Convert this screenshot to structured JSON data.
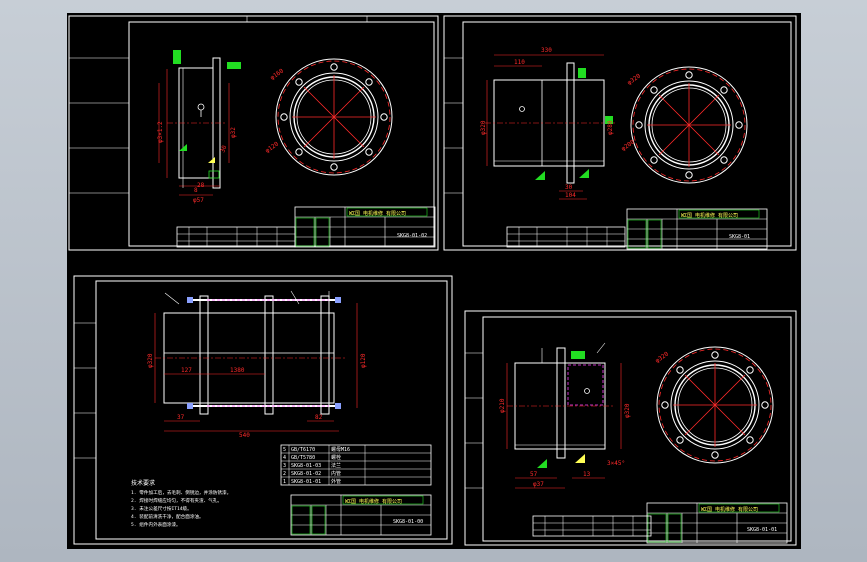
{
  "viewport": {
    "name": "model-space"
  },
  "sheets": [
    {
      "id": "top-left",
      "dims": {
        "d1": "φ57",
        "d2": "8",
        "d3": "30",
        "d4": "28",
        "d5": "φ3×1.2",
        "d6": "φ32"
      },
      "table_title": "WΣ国 电机维修 有限公司",
      "drawing_no": "SKG8-01-02"
    },
    {
      "id": "top-right",
      "dims": {
        "d1": "330",
        "d2": "110",
        "d3": "φ320",
        "d4": "30",
        "d5": "104",
        "d6": "φ280"
      },
      "table_title": "WΣ国 电机维修 有限公司",
      "drawing_no": "SKG8-01"
    },
    {
      "id": "bottom-left",
      "dims": {
        "d1": "127",
        "d2": "1380",
        "d3": "37",
        "d4": "82",
        "d5": "540",
        "d6": "φ320",
        "d7": "φ120"
      },
      "notes_title": "技术要求",
      "notes": [
        "1. 零件加工后，去毛刺、倒锐边，并涂防锈漆。",
        "2. 焊接时焊缝应均匀，不得有夹渣、气孔。",
        "3. 未注公差尺寸按IT14级。",
        "4. 装配前清洗干净，配合面涂油。",
        "5. 组件内外表面涂漆。"
      ],
      "bom": [
        {
          "no": "5",
          "code": "GB/T6170",
          "name": "螺母M16"
        },
        {
          "no": "4",
          "code": "GB/T5780",
          "name": "螺栓"
        },
        {
          "no": "3",
          "code": "SKG8-01-03",
          "name": "法兰"
        },
        {
          "no": "2",
          "code": "SKG8-01-02",
          "name": "内管"
        },
        {
          "no": "1",
          "code": "SKG8-01-01",
          "name": "外管"
        }
      ],
      "table_title": "WΣ国 电机维修 有限公司",
      "drawing_no": "SKG8-01-00"
    },
    {
      "id": "bottom-right",
      "dims": {
        "d1": "φ210",
        "d2": "57",
        "d3": "φ37",
        "d4": "13",
        "d5": "3×45°",
        "d6": "φ320"
      },
      "table_title": "WΣ国 电机维修 有限公司",
      "drawing_no": "SKG8-01-01"
    }
  ],
  "colors": {
    "frame": "#ffffff",
    "dim": "#ff2a2a",
    "geometry": "#ffffff",
    "hatch": "#8aa0ff",
    "green": "#22dd22",
    "magenta": "#ff44ff",
    "yellow": "#ffff55"
  }
}
